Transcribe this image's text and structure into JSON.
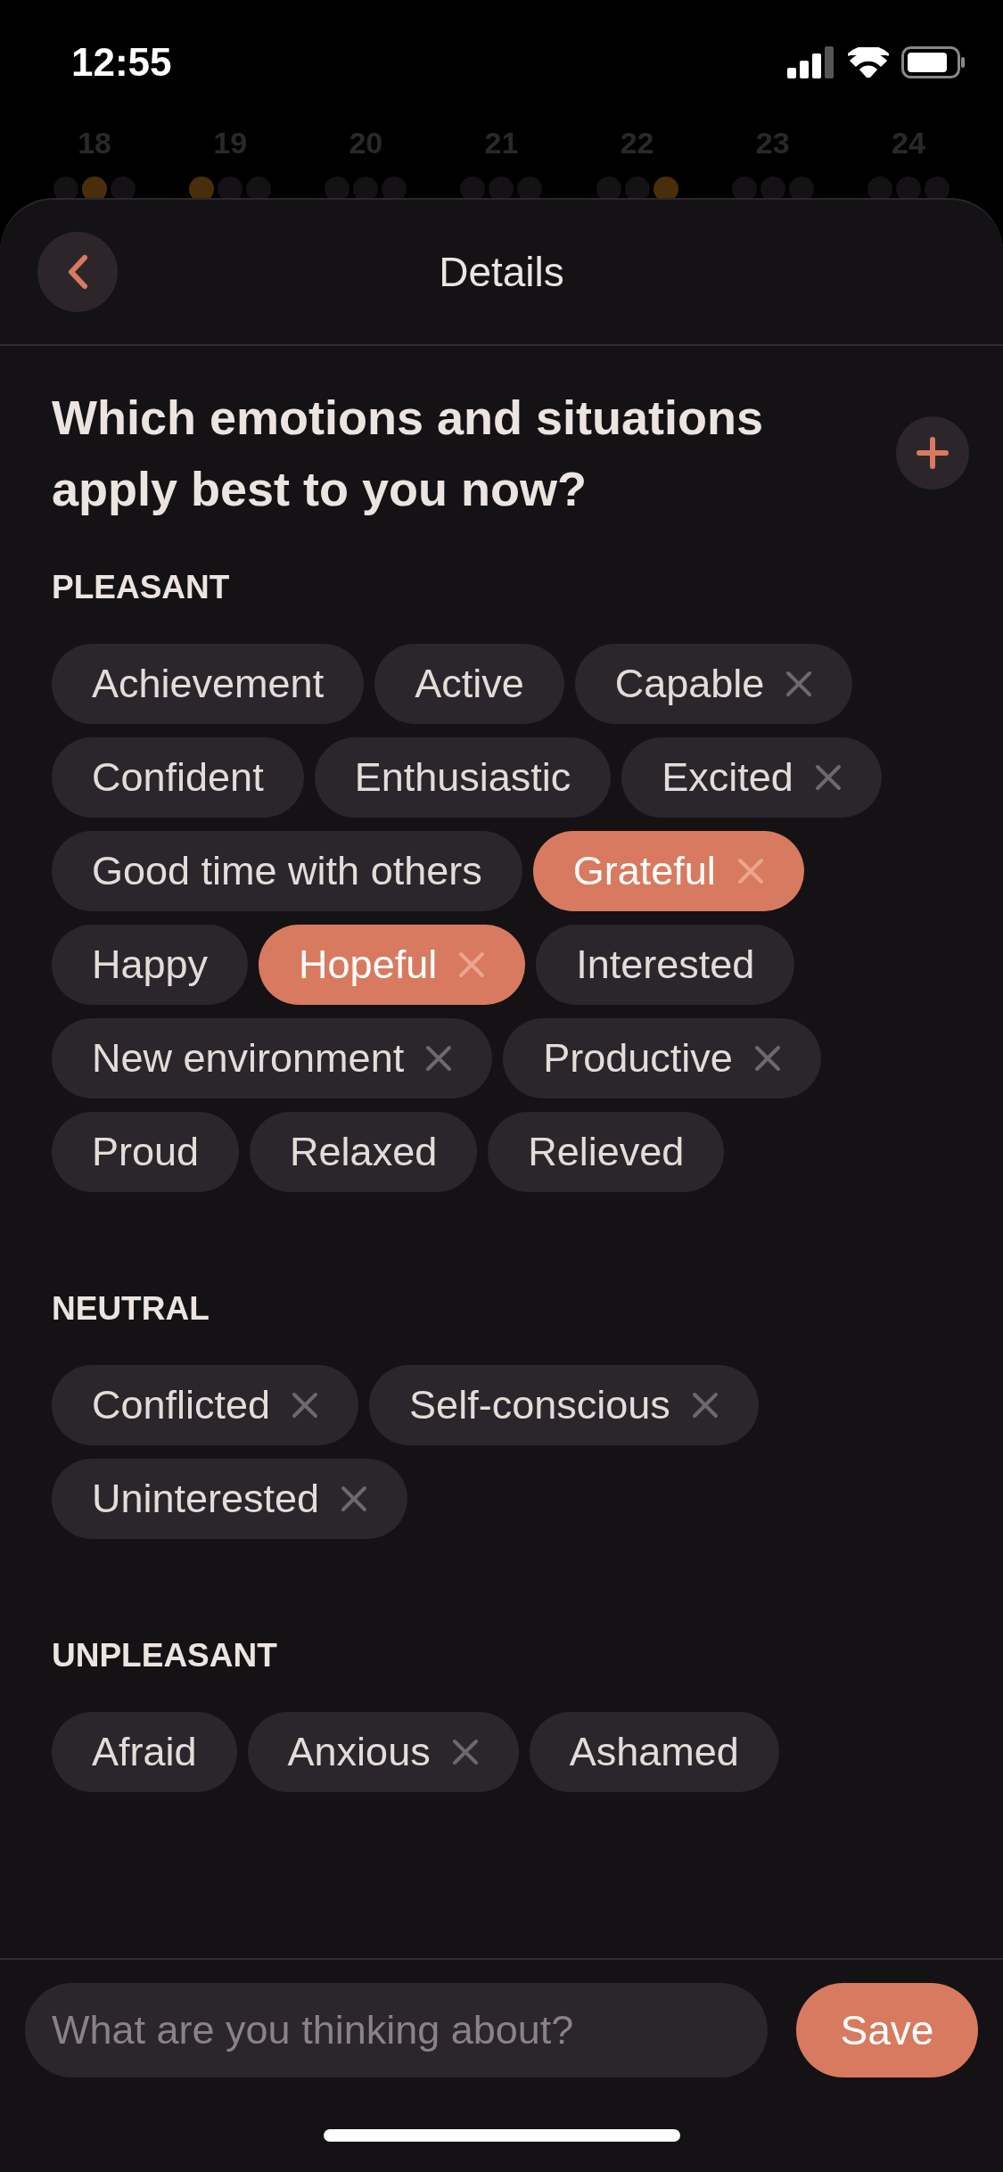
{
  "status_bar": {
    "time": "12:55"
  },
  "calendar": [
    {
      "date": "18",
      "dots": [
        false,
        true,
        false
      ]
    },
    {
      "date": "19",
      "dots": [
        true,
        false,
        false
      ]
    },
    {
      "date": "20",
      "dots": [
        false,
        false,
        false
      ]
    },
    {
      "date": "21",
      "dots": [
        false,
        false,
        false
      ]
    },
    {
      "date": "22",
      "dots": [
        false,
        false,
        true
      ]
    },
    {
      "date": "23",
      "dots": [
        false,
        false,
        false
      ]
    },
    {
      "date": "24",
      "dots": [
        false,
        false,
        false
      ]
    }
  ],
  "header": {
    "title": "Details"
  },
  "question": "Which emotions and situations apply best to you now?",
  "sections": [
    {
      "label": "PLEASANT",
      "chips": [
        {
          "label": "Achievement",
          "selected": false,
          "removable": false
        },
        {
          "label": "Active",
          "selected": false,
          "removable": false
        },
        {
          "label": "Capable",
          "selected": false,
          "removable": true
        },
        {
          "label": "Confident",
          "selected": false,
          "removable": false
        },
        {
          "label": "Enthusiastic",
          "selected": false,
          "removable": false
        },
        {
          "label": "Excited",
          "selected": false,
          "removable": true
        },
        {
          "label": "Good time with others",
          "selected": false,
          "removable": false
        },
        {
          "label": "Grateful",
          "selected": true,
          "removable": true
        },
        {
          "label": "Happy",
          "selected": false,
          "removable": false
        },
        {
          "label": "Hopeful",
          "selected": true,
          "removable": true
        },
        {
          "label": "Interested",
          "selected": false,
          "removable": false
        },
        {
          "label": "New environment",
          "selected": false,
          "removable": true
        },
        {
          "label": "Productive",
          "selected": false,
          "removable": true
        },
        {
          "label": "Proud",
          "selected": false,
          "removable": false
        },
        {
          "label": "Relaxed",
          "selected": false,
          "removable": false
        },
        {
          "label": "Relieved",
          "selected": false,
          "removable": false
        }
      ]
    },
    {
      "label": "NEUTRAL",
      "chips": [
        {
          "label": "Conflicted",
          "selected": false,
          "removable": true
        },
        {
          "label": "Self-conscious",
          "selected": false,
          "removable": true
        },
        {
          "label": "Uninterested",
          "selected": false,
          "removable": true
        }
      ]
    },
    {
      "label": "UNPLEASANT",
      "chips": [
        {
          "label": "Afraid",
          "selected": false,
          "removable": false
        },
        {
          "label": "Anxious",
          "selected": false,
          "removable": true
        },
        {
          "label": "Ashamed",
          "selected": false,
          "removable": false
        }
      ]
    }
  ],
  "composer": {
    "placeholder": "What are you thinking about?",
    "button": "Save"
  }
}
